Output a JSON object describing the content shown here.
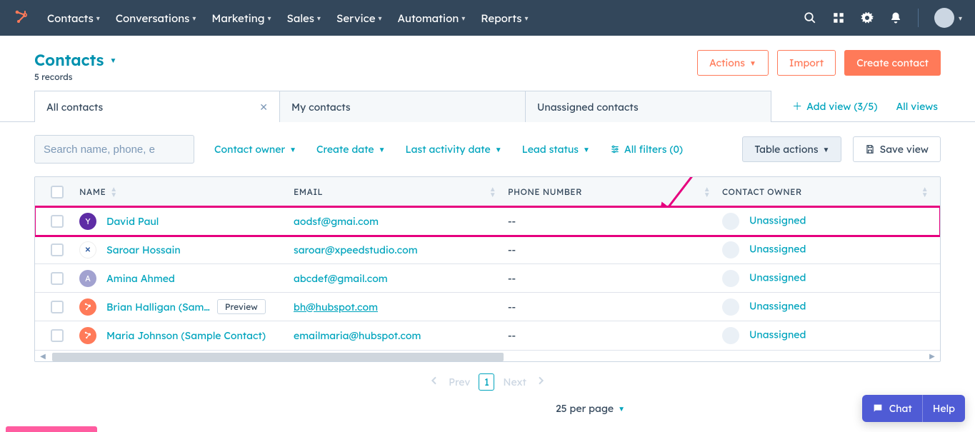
{
  "nav": {
    "items": [
      "Contacts",
      "Conversations",
      "Marketing",
      "Sales",
      "Service",
      "Automation",
      "Reports"
    ]
  },
  "header": {
    "title": "Contacts",
    "subtitle": "5 records",
    "actions_label": "Actions",
    "import_label": "Import",
    "create_label": "Create contact"
  },
  "tabs": {
    "items": [
      {
        "label": "All contacts",
        "active": true,
        "closable": true
      },
      {
        "label": "My contacts",
        "active": false,
        "closable": false
      },
      {
        "label": "Unassigned contacts",
        "active": false,
        "closable": false
      }
    ],
    "add_view_label": "Add view (3/5)",
    "all_views_label": "All views"
  },
  "filters": {
    "search_placeholder": "Search name, phone, e",
    "owner": "Contact owner",
    "created": "Create date",
    "activity": "Last activity date",
    "lead": "Lead status",
    "all_filters": "All filters (0)",
    "table_actions": "Table actions",
    "save_view": "Save view"
  },
  "table": {
    "headers": {
      "name": "NAME",
      "email": "EMAIL",
      "phone": "PHONE NUMBER",
      "owner": "CONTACT OWNER"
    },
    "rows": [
      {
        "name": "David Paul",
        "email": "aodsf@gmai.com",
        "phone": "--",
        "owner": "Unassigned",
        "avatar": "purple",
        "avatar_txt": "Y",
        "highlight": true
      },
      {
        "name": "Saroar Hossain",
        "email": "saroar@xpeedstudio.com",
        "phone": "--",
        "owner": "Unassigned",
        "avatar": "x",
        "avatar_txt": "✕"
      },
      {
        "name": "Amina Ahmed",
        "email": "abcdef@gmail.com",
        "phone": "--",
        "owner": "Unassigned",
        "avatar": "a",
        "avatar_txt": "A"
      },
      {
        "name": "Brian Halligan (Sam…",
        "email": "bh@hubspot.com",
        "phone": "--",
        "owner": "Unassigned",
        "avatar": "hs",
        "avatar_txt": "",
        "preview": true,
        "underline_email": true
      },
      {
        "name": "Maria Johnson (Sample Contact)",
        "email": "emailmaria@hubspot.com",
        "phone": "--",
        "owner": "Unassigned",
        "avatar": "hs",
        "avatar_txt": ""
      }
    ],
    "preview_label": "Preview"
  },
  "pager": {
    "prev": "Prev",
    "next": "Next",
    "current": "1",
    "per_page": "25 per page"
  },
  "chat": {
    "chat": "Chat",
    "help": "Help"
  }
}
